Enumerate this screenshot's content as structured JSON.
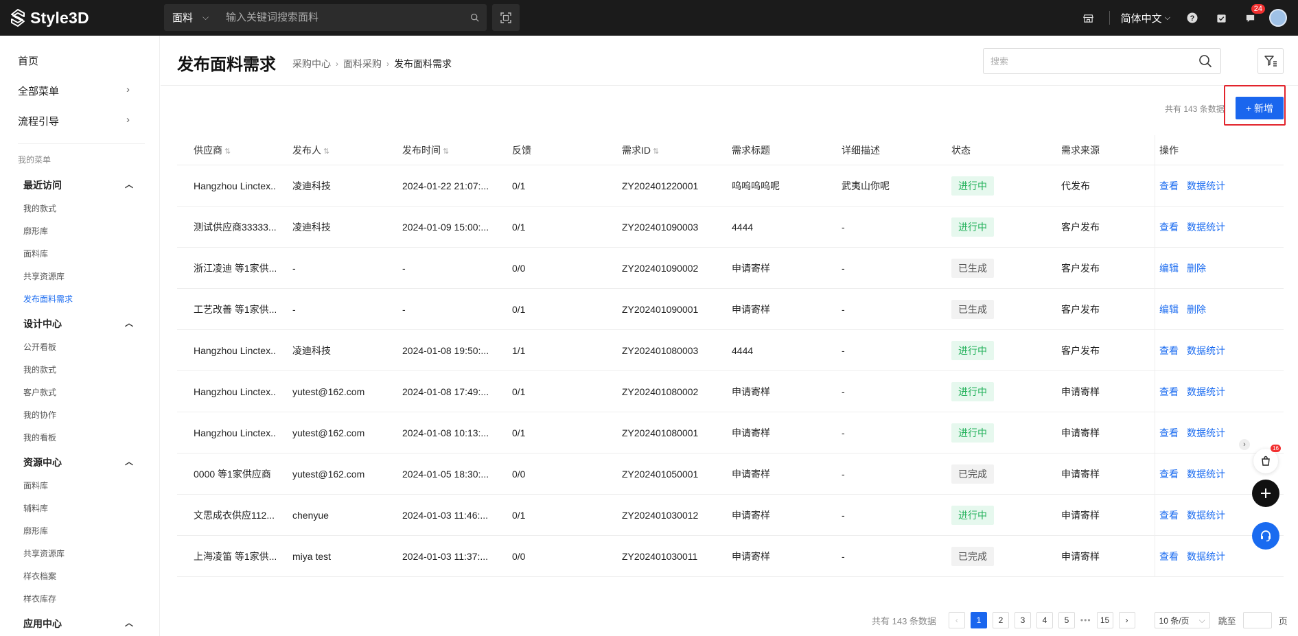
{
  "topbar": {
    "logo_text": "Style3D",
    "search_category": "面料",
    "search_placeholder": "输入关键词搜索面料",
    "language": "简体中文",
    "message_badge": "24"
  },
  "sidebar": {
    "home": "首页",
    "all_menu": "全部菜单",
    "flow_guide": "流程引导",
    "my_menu_label": "我的菜单",
    "groups": [
      {
        "title": "最近访问",
        "items": [
          "我的款式",
          "廓形库",
          "面料库",
          "共享资源库",
          "发布面料需求"
        ]
      },
      {
        "title": "设计中心",
        "items": [
          "公开看板",
          "我的款式",
          "客户款式",
          "我的协作",
          "我的看板"
        ]
      },
      {
        "title": "资源中心",
        "items": [
          "面料库",
          "辅料库",
          "廓形库",
          "共享资源库",
          "样衣档案",
          "样衣库存"
        ]
      },
      {
        "title": "应用中心",
        "items": []
      }
    ]
  },
  "page": {
    "title": "发布面料需求",
    "breadcrumb": [
      "采购中心",
      "面料采购",
      "发布面料需求"
    ],
    "search_placeholder": "搜索",
    "count_text": "共有 143 条数据",
    "add_button": "+ 新增"
  },
  "table": {
    "headers": [
      "供应商",
      "发布人",
      "发布时间",
      "反馈",
      "需求ID",
      "需求标题",
      "详细描述",
      "状态",
      "需求来源",
      "操作"
    ],
    "rows": [
      {
        "supplier": "Hangzhou Linctex...",
        "publisher": "凌迪科技",
        "time": "2024-01-22 21:07:...",
        "feedback": "0/1",
        "id": "ZY202401220001",
        "title": "呜呜呜呜呢",
        "desc": "武夷山你呢",
        "status": "进行中",
        "status_type": "green",
        "source": "代发布",
        "ops": [
          "查看",
          "数据统计"
        ]
      },
      {
        "supplier": "测试供应商33333...",
        "publisher": "凌迪科技",
        "time": "2024-01-09 15:00:...",
        "feedback": "0/1",
        "id": "ZY202401090003",
        "title": "4444",
        "desc": "-",
        "status": "进行中",
        "status_type": "green",
        "source": "客户发布",
        "ops": [
          "查看",
          "数据统计"
        ]
      },
      {
        "supplier": "浙江凌迪 等1家供...",
        "publisher": "-",
        "time": "-",
        "feedback": "0/0",
        "id": "ZY202401090002",
        "title": "申请寄样",
        "desc": "-",
        "status": "已生成",
        "status_type": "grey",
        "source": "客户发布",
        "ops": [
          "编辑",
          "删除"
        ]
      },
      {
        "supplier": "工艺改善 等1家供...",
        "publisher": "-",
        "time": "-",
        "feedback": "0/1",
        "id": "ZY202401090001",
        "title": "申请寄样",
        "desc": "-",
        "status": "已生成",
        "status_type": "grey",
        "source": "客户发布",
        "ops": [
          "编辑",
          "删除"
        ]
      },
      {
        "supplier": "Hangzhou Linctex...",
        "publisher": "凌迪科技",
        "time": "2024-01-08 19:50:...",
        "feedback": "1/1",
        "id": "ZY202401080003",
        "title": "4444",
        "desc": "-",
        "status": "进行中",
        "status_type": "green",
        "source": "客户发布",
        "ops": [
          "查看",
          "数据统计"
        ]
      },
      {
        "supplier": "Hangzhou Linctex...",
        "publisher": "yutest@162.com",
        "time": "2024-01-08 17:49:...",
        "feedback": "0/1",
        "id": "ZY202401080002",
        "title": "申请寄样",
        "desc": "-",
        "status": "进行中",
        "status_type": "green",
        "source": "申请寄样",
        "ops": [
          "查看",
          "数据统计"
        ]
      },
      {
        "supplier": "Hangzhou Linctex...",
        "publisher": "yutest@162.com",
        "time": "2024-01-08 10:13:...",
        "feedback": "0/1",
        "id": "ZY202401080001",
        "title": "申请寄样",
        "desc": "-",
        "status": "进行中",
        "status_type": "green",
        "source": "申请寄样",
        "ops": [
          "查看",
          "数据统计"
        ]
      },
      {
        "supplier": "0000 等1家供应商",
        "publisher": "yutest@162.com",
        "time": "2024-01-05 18:30:...",
        "feedback": "0/0",
        "id": "ZY202401050001",
        "title": "申请寄样",
        "desc": "-",
        "status": "已完成",
        "status_type": "grey",
        "source": "申请寄样",
        "ops": [
          "查看",
          "数据统计"
        ]
      },
      {
        "supplier": "文思成衣供应112...",
        "publisher": "chenyue",
        "time": "2024-01-03 11:46:...",
        "feedback": "0/1",
        "id": "ZY202401030012",
        "title": "申请寄样",
        "desc": "-",
        "status": "进行中",
        "status_type": "green",
        "source": "申请寄样",
        "ops": [
          "查看",
          "数据统计"
        ]
      },
      {
        "supplier": "上海凌笛 等1家供...",
        "publisher": "miya test",
        "time": "2024-01-03 11:37:...",
        "feedback": "0/0",
        "id": "ZY202401030011",
        "title": "申请寄样",
        "desc": "-",
        "status": "已完成",
        "status_type": "grey",
        "source": "申请寄样",
        "ops": [
          "查看",
          "数据统计"
        ]
      }
    ]
  },
  "pagination": {
    "total_text": "共有 143 条数据",
    "pages": [
      "1",
      "2",
      "3",
      "4",
      "5"
    ],
    "last_page": "15",
    "current": "1",
    "page_size": "10 条/页",
    "jump_label": "跳至",
    "page_unit": "页"
  },
  "floating": {
    "cart_badge": "16"
  },
  "colors": {
    "accent": "#1a66ee",
    "status_green": "#22b15a",
    "highlight_red": "#e2242c",
    "topbar_bg": "#1b1b1b"
  }
}
